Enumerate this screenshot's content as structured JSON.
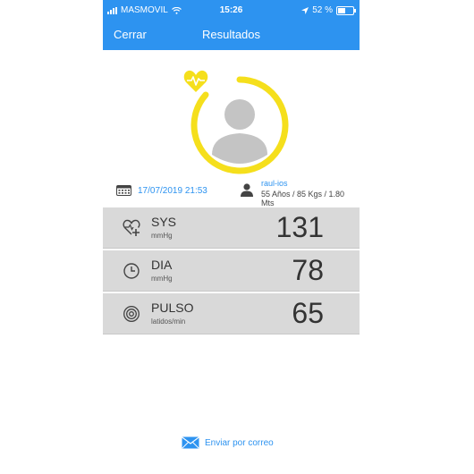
{
  "status": {
    "carrier": "MASMOVIL",
    "time": "15:26",
    "battery": "52 %",
    "battery_level": 0.52
  },
  "nav": {
    "close_label": "Cerrar",
    "title": "Resultados"
  },
  "session": {
    "date": "17/07/2019 21:53",
    "user_name": "raul-ios",
    "user_info": "55 Años / 85 Kgs / 1.80 Mts"
  },
  "metrics": [
    {
      "name": "SYS",
      "unit": "mmHg",
      "value": "131",
      "icon": "heart-plus-icon"
    },
    {
      "name": "DIA",
      "unit": "mmHg",
      "value": "78",
      "icon": "clock-icon"
    },
    {
      "name": "PULSO",
      "unit": "latidos/min",
      "value": "65",
      "icon": "pulse-circle-icon"
    }
  ],
  "actions": {
    "email_label": "Enviar por correo"
  },
  "colors": {
    "accent": "#2d93f0",
    "ring": "#f5df1c",
    "metric_bg": "#d9d9d9"
  }
}
